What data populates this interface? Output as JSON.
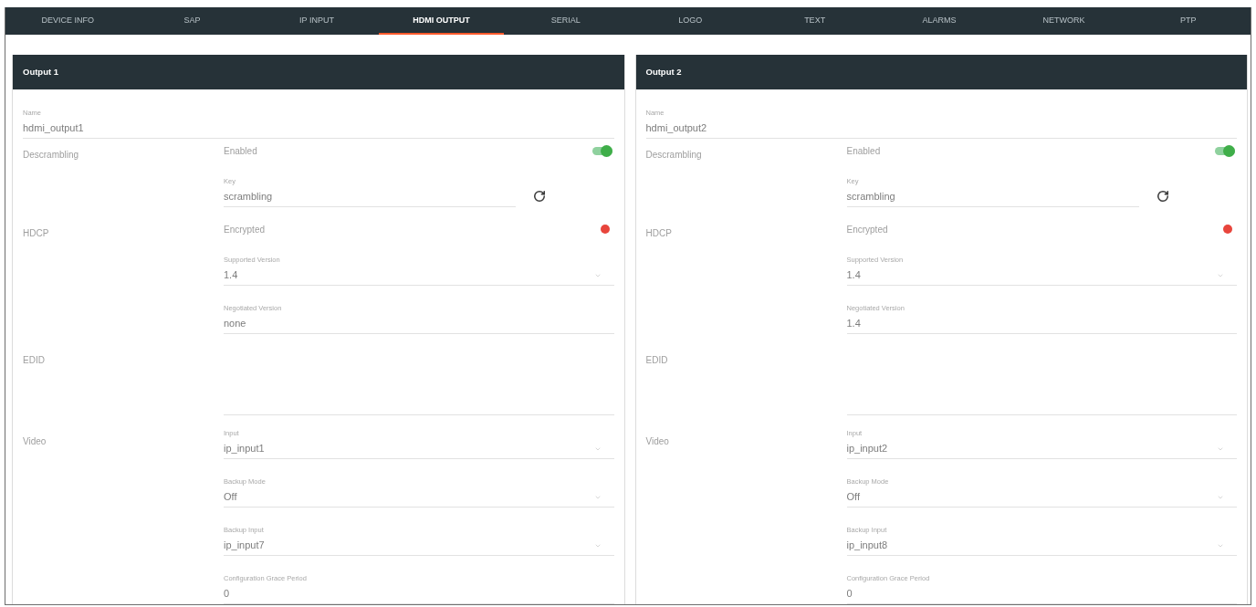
{
  "tabs": [
    {
      "label": "DEVICE INFO",
      "selected": false
    },
    {
      "label": "SAP",
      "selected": false
    },
    {
      "label": "IP INPUT",
      "selected": false
    },
    {
      "label": "HDMI OUTPUT",
      "selected": true
    },
    {
      "label": "SERIAL",
      "selected": false
    },
    {
      "label": "LOGO",
      "selected": false
    },
    {
      "label": "TEXT",
      "selected": false
    },
    {
      "label": "ALARMS",
      "selected": false
    },
    {
      "label": "NETWORK",
      "selected": false
    },
    {
      "label": "PTP",
      "selected": false
    }
  ],
  "outputs": [
    {
      "title": "Output 1",
      "name": {
        "label": "Name",
        "value": "hdmi_output1"
      },
      "sections": [
        {
          "label": "Descrambling",
          "fields": [
            {
              "kind": "toggle",
              "label": "Enabled",
              "on": true
            },
            {
              "kind": "keyfield",
              "label": "Key",
              "value": "scrambling"
            }
          ]
        },
        {
          "label": "HDCP",
          "fields": [
            {
              "kind": "status",
              "label": "Encrypted",
              "color": "#e8453c"
            },
            {
              "kind": "select",
              "label": "Supported Version",
              "value": "1.4"
            },
            {
              "kind": "text",
              "label": "Negotiated Version",
              "value": "none"
            }
          ]
        },
        {
          "label": "EDID",
          "fields": [
            {
              "kind": "textarea"
            }
          ]
        },
        {
          "label": "Video",
          "fields": [
            {
              "kind": "select",
              "label": "Input",
              "value": "ip_input1"
            },
            {
              "kind": "select",
              "label": "Backup Mode",
              "value": "Off"
            },
            {
              "kind": "select",
              "label": "Backup Input",
              "value": "ip_input7"
            },
            {
              "kind": "text",
              "label": "Configuration Grace Period",
              "value": "0"
            }
          ]
        }
      ]
    },
    {
      "title": "Output 2",
      "name": {
        "label": "Name",
        "value": "hdmi_output2"
      },
      "sections": [
        {
          "label": "Descrambling",
          "fields": [
            {
              "kind": "toggle",
              "label": "Enabled",
              "on": true
            },
            {
              "kind": "keyfield",
              "label": "Key",
              "value": "scrambling"
            }
          ]
        },
        {
          "label": "HDCP",
          "fields": [
            {
              "kind": "status",
              "label": "Encrypted",
              "color": "#e8453c"
            },
            {
              "kind": "select",
              "label": "Supported Version",
              "value": "1.4"
            },
            {
              "kind": "text",
              "label": "Negotiated Version",
              "value": "1.4"
            }
          ]
        },
        {
          "label": "EDID",
          "fields": [
            {
              "kind": "textarea"
            }
          ]
        },
        {
          "label": "Video",
          "fields": [
            {
              "kind": "select",
              "label": "Input",
              "value": "ip_input2"
            },
            {
              "kind": "select",
              "label": "Backup Mode",
              "value": "Off"
            },
            {
              "kind": "select",
              "label": "Backup Input",
              "value": "ip_input8"
            },
            {
              "kind": "text",
              "label": "Configuration Grace Period",
              "value": "0"
            }
          ]
        }
      ]
    }
  ]
}
